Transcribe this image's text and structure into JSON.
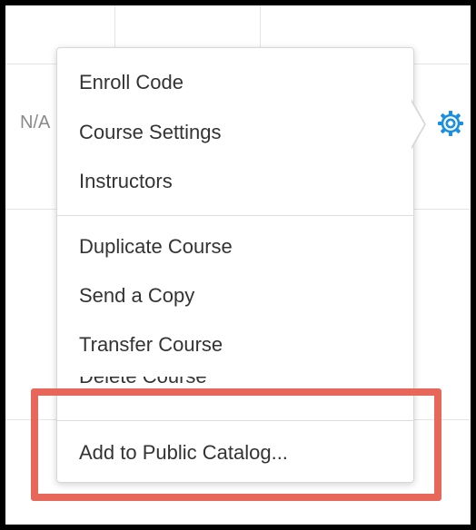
{
  "background": {
    "cell_text": "N/A"
  },
  "menu": {
    "items": [
      {
        "label": "Enroll Code"
      },
      {
        "label": "Course Settings"
      },
      {
        "label": "Instructors"
      },
      {
        "label": "Duplicate Course"
      },
      {
        "label": "Send a Copy"
      },
      {
        "label": "Transfer Course"
      },
      {
        "label": "Delete Course"
      },
      {
        "label": "Add to Public Catalog..."
      }
    ]
  },
  "colors": {
    "gear_icon": "#1a8fe0",
    "highlight": "#e8675b"
  }
}
